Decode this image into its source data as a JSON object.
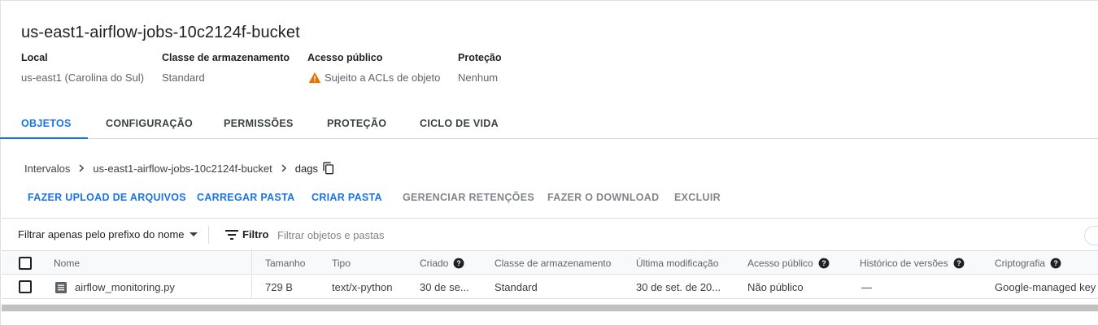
{
  "bucket": {
    "title": "us-east1-airflow-jobs-10c2124f-bucket",
    "details": [
      {
        "label": "Local",
        "value": "us-east1 (Carolina do Sul)"
      },
      {
        "label": "Classe de armazenamento",
        "value": "Standard"
      },
      {
        "label": "Acesso público",
        "value": "Sujeito a ACLs de objeto",
        "icon": "warning-icon",
        "icon_color": "#e37400"
      },
      {
        "label": "Proteção",
        "value": "Nenhum"
      }
    ]
  },
  "tabs": [
    {
      "label": "OBJETOS",
      "active": true
    },
    {
      "label": "CONFIGURAÇÃO"
    },
    {
      "label": "PERMISSÕES"
    },
    {
      "label": "PROTEÇÃO"
    },
    {
      "label": "CICLO DE VIDA"
    }
  ],
  "breadcrumb": {
    "items": [
      "Intervalos",
      "us-east1-airflow-jobs-10c2124f-bucket",
      "dags"
    ],
    "copy_icon": "copy-icon"
  },
  "actions": [
    {
      "label": "FAZER UPLOAD DE ARQUIVOS",
      "enabled": true
    },
    {
      "label": "CARREGAR PASTA",
      "enabled": true
    },
    {
      "label": "CRIAR PASTA",
      "enabled": true
    },
    {
      "label": "GERENCIAR RETENÇÕES",
      "enabled": false
    },
    {
      "label": "FAZER O DOWNLOAD",
      "enabled": false
    },
    {
      "label": "EXCLUIR",
      "enabled": false
    }
  ],
  "filter": {
    "prefix_select": "Filtrar apenas pelo prefixo do nome",
    "label": "Filtro",
    "placeholder": "Filtrar objetos e pastas"
  },
  "table": {
    "headers": [
      "Nome",
      "Tamanho",
      "Tipo",
      "Criado",
      "Classe de armazenamento",
      "Última modificação",
      "Acesso público",
      "Histórico de versões",
      "Criptografia"
    ],
    "rows": [
      {
        "name": "airflow_monitoring.py",
        "size": "729 B",
        "type": "text/x-python",
        "created": "30 de se...",
        "storage_class": "Standard",
        "modified": "30 de set. de 20...",
        "public_access": "Não público",
        "version_history": "—",
        "encryption": "Google-managed key"
      }
    ]
  },
  "colors": {
    "accent": "#1a73e8",
    "warning": "#e37400",
    "disabled": "#80868b"
  }
}
